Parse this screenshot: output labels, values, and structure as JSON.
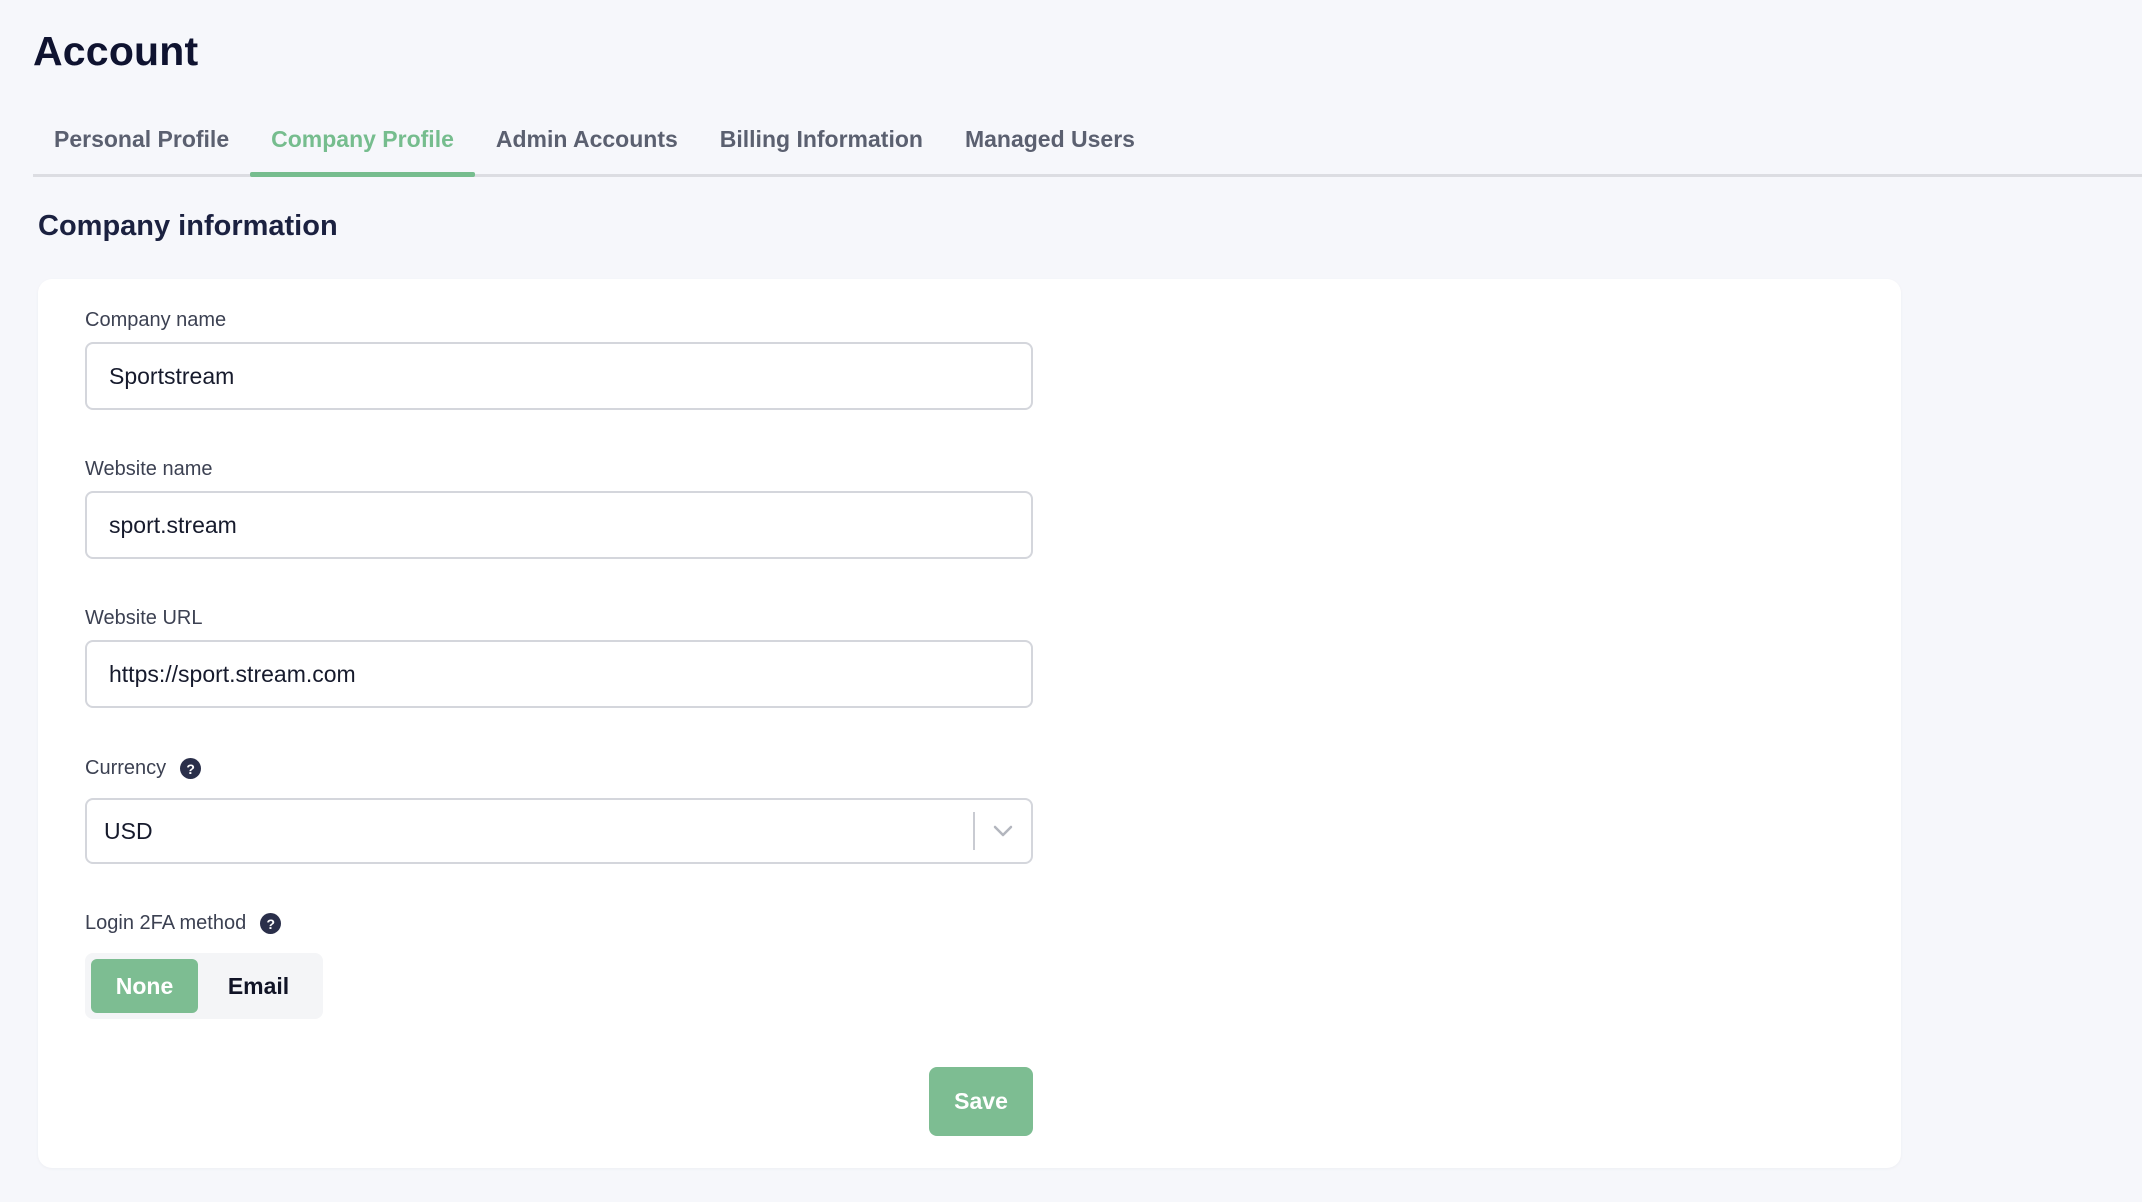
{
  "page": {
    "title": "Account"
  },
  "tabs": [
    {
      "label": "Personal Profile",
      "active": false
    },
    {
      "label": "Company Profile",
      "active": true
    },
    {
      "label": "Admin Accounts",
      "active": false
    },
    {
      "label": "Billing Information",
      "active": false
    },
    {
      "label": "Managed Users",
      "active": false
    }
  ],
  "section": {
    "title": "Company information"
  },
  "form": {
    "company_name": {
      "label": "Company name",
      "value": "Sportstream"
    },
    "website_name": {
      "label": "Website name",
      "value": "sport.stream"
    },
    "website_url": {
      "label": "Website URL",
      "value": "https://sport.stream.com"
    },
    "currency": {
      "label": "Currency",
      "help_icon": "question-circle-icon",
      "value": "USD",
      "chevron_icon": "chevron-down-icon"
    },
    "twofa": {
      "label": "Login 2FA method",
      "help_icon": "question-circle-icon",
      "options": [
        "None",
        "Email"
      ],
      "selected": "None"
    },
    "save_label": "Save"
  },
  "colors": {
    "accent": "#7dbd92",
    "active_tab": "#76bd8e",
    "background": "#f6f7fb",
    "card": "#ffffff",
    "help_icon_bg": "#2a2f4a"
  }
}
